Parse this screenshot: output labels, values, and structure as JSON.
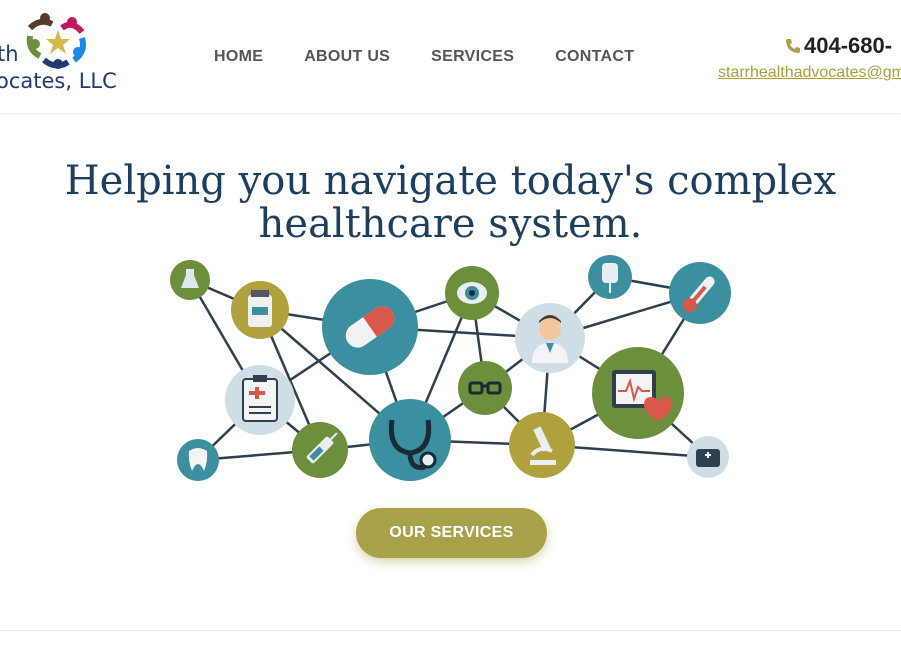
{
  "header": {
    "logo_line1": "th",
    "logo_line2": "ocates, LLC",
    "nav": [
      "HOME",
      "ABOUT US",
      "SERVICES",
      "CONTACT"
    ],
    "phone": "404-680-",
    "email": "starrhealthadvocates@gm"
  },
  "hero": {
    "title": "Helping you navigate today's complex healthcare system.",
    "cta_label": "OUR SERVICES"
  },
  "colors": {
    "brand_navy": "#1d3f5e",
    "accent_olive": "#a9a149",
    "teal": "#3b8f9e",
    "green": "#6b8f3b"
  },
  "graphic_icons": [
    "flask-icon",
    "medicine-bottle-icon",
    "pill-icon",
    "eye-icon",
    "iv-bag-icon",
    "thermometer-icon",
    "doctor-icon",
    "clipboard-icon",
    "glasses-icon",
    "heart-monitor-icon",
    "tooth-icon",
    "syringe-icon",
    "stethoscope-icon",
    "microscope-icon",
    "first-aid-kit-icon"
  ]
}
